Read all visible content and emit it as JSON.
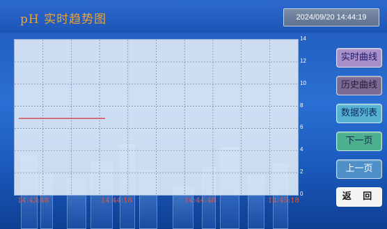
{
  "header": {
    "title": "pH  实时趋势图",
    "datetime": "2024/09/20 14:44:19"
  },
  "buttons": {
    "realtime": "实时曲线",
    "history": "历史曲线",
    "list": "数据列表",
    "next": "下一页",
    "prev": "上一页",
    "back": "返 回"
  },
  "chart_data": {
    "type": "line",
    "title": "",
    "xlabel": "",
    "ylabel": "",
    "ylim": [
      0,
      14
    ],
    "x_ticks": [
      "14:43:48",
      "14:44:18",
      "14:44:48",
      "14:45:18"
    ],
    "y_ticks": [
      "0",
      "2",
      "4",
      "6",
      "8",
      "10",
      "12",
      "14"
    ],
    "grid": true,
    "series": [
      {
        "color": "#d93030",
        "points": [
          {
            "x": "14:43:48",
            "y": 6.9
          },
          {
            "x": "14:44:19",
            "y": 6.9
          }
        ]
      }
    ]
  }
}
